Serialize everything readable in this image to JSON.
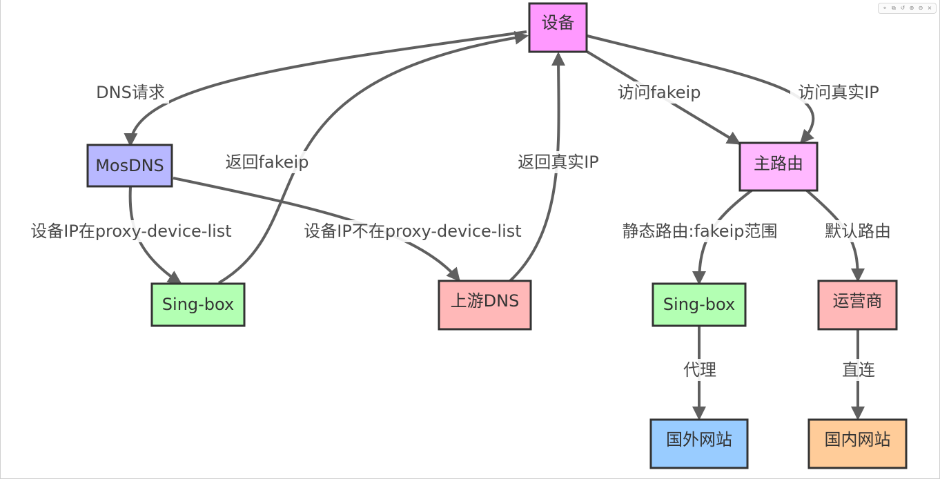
{
  "nodes": {
    "device": {
      "label": "设备",
      "fill": "#ff99ff"
    },
    "mosdns": {
      "label": "MosDNS",
      "fill": "#b8b8ff"
    },
    "singbox_dns": {
      "label": "Sing-box",
      "fill": "#b3ffb3"
    },
    "upstream_dns": {
      "label": "上游DNS",
      "fill": "#ffb8b8"
    },
    "main_router": {
      "label": "主路由",
      "fill": "#ffb8ff"
    },
    "singbox_proxy": {
      "label": "Sing-box",
      "fill": "#b3ffb3"
    },
    "isp": {
      "label": "运营商",
      "fill": "#ffb8b8"
    },
    "foreign_site": {
      "label": "国外网站",
      "fill": "#99ccff"
    },
    "domestic_site": {
      "label": "国内网站",
      "fill": "#ffcc99"
    }
  },
  "edges": {
    "dns_request": "DNS请求",
    "return_fakeip": "返回fakeip",
    "return_real_ip": "返回真实IP",
    "visit_fakeip": "访问fakeip",
    "visit_real_ip": "访问真实IP",
    "in_proxy_list": "设备IP在proxy-device-list",
    "not_in_proxy_list": "设备IP不在proxy-device-list",
    "static_route": "静态路由:fakeip范围",
    "default_route": "默认路由",
    "proxy": "代理",
    "direct": "直连"
  },
  "toolbar": {
    "icons": [
      "pin-icon",
      "copy-icon",
      "reset-icon",
      "zoom-in-icon",
      "zoom-out-icon",
      "close-icon"
    ],
    "glyphs": [
      "⌖",
      "⧉",
      "↺",
      "⊕",
      "⊖",
      "×"
    ]
  },
  "colors": {
    "edge": "#5f5f5f",
    "border": "#333333"
  }
}
